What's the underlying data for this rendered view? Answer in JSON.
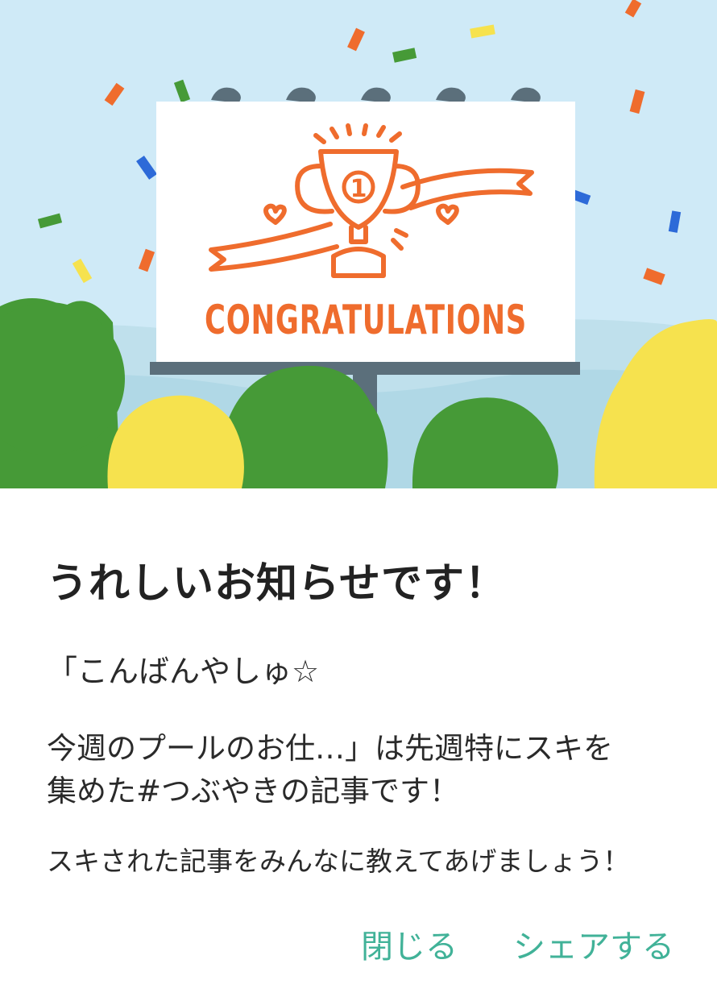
{
  "hero": {
    "sign_text": "CONGRATULATIONS",
    "trophy_number": "1",
    "colors": {
      "sky": "#cfeaf7",
      "accent_orange": "#ef6c2d",
      "tree_green": "#469a37",
      "tree_yellow": "#f6e24e",
      "pole": "#5b6f7b"
    }
  },
  "dialog": {
    "title": "うれしいお知らせです！",
    "message_line1": "「こんばんやしゅ☆",
    "message_line2": "今週のプールのお仕…」は先週特にスキを",
    "message_line3": "集めた#つぶやきの記事です！",
    "message_line4": "スキされた記事をみんなに教えてあげましょう！"
  },
  "actions": {
    "close_label": "閉じる",
    "share_label": "シェアする",
    "accent_color": "#41b298"
  }
}
